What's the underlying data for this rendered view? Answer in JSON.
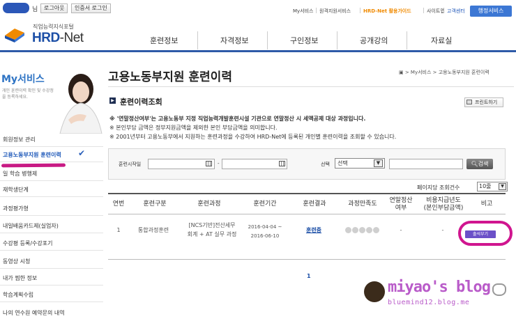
{
  "top": {
    "user_suffix": "님",
    "logout": "로그아웃",
    "cert_login": "인증서 로그인",
    "links": [
      "My서비스",
      "원격지원서비스",
      "HRD-Net 활용가이드",
      "사이트맵",
      "고객센터"
    ],
    "admin": "행정서비스"
  },
  "logo": {
    "sub": "직업능력지식포털",
    "main_a": "HRD",
    "main_b": "-Net"
  },
  "nav": [
    "훈련정보",
    "자격정보",
    "구인정보",
    "공개강의",
    "자료실"
  ],
  "sidebar": {
    "title": "My서비스",
    "desc": "개인 훈련이력 확인 및 수강정을 등록하세요.",
    "items": [
      "회원정보 관리",
      "고용노동부지원 훈련이력",
      "일 학습 병행제",
      "재학생단계",
      "과정평가형",
      "내일배움카드제(실업자)",
      "수강평 등록/수강포기",
      "동영상 시청",
      "내가 찜한 정보",
      "학습계획수립",
      "나의 연수원 예약문의 내역"
    ]
  },
  "page": {
    "title": "고용노동부지원 훈련이력",
    "breadcrumb": "▣ > My서비스 > 고용노동부지원 훈련이력",
    "section": "훈련이력조회",
    "print": "프린트하기"
  },
  "notes": [
    "※ '연말정산여부'는 고용노동부 지정 직업능력개발훈련시설 기관으로 연말정산 시 세액공제 대상 과정입니다.",
    "※ 본인부담 금액은 정부지원금액을 제외한 본인 부담금액을 의미합니다.",
    "※ 2001년부터 고용노동부에서 지원하는 훈련과정을 수강하여 HRD-Net에 등록된 개인별 훈련이력을 조회할 수 있습니다."
  ],
  "search": {
    "start_label": "훈련시작일",
    "dash": "-",
    "select_label": "선택",
    "select_value": "선택",
    "button": "검색"
  },
  "perpage": {
    "label": "페이지당 조회건수",
    "value": "10줄"
  },
  "table": {
    "headers": [
      "연번",
      "훈련구분",
      "훈련과정",
      "훈련기간",
      "훈련결과",
      "과정만족도",
      "연말정산\n여부",
      "비용지급년도\n(본인부담금액)",
      "비고"
    ],
    "row": {
      "no": "1",
      "type": "통합과정훈련",
      "course_1": "[NCS기반]전산세무",
      "course_2": "회계 + AT 실무 과정",
      "period_1": "2016-04-04 ~",
      "period_2": "2016-06-10",
      "result": "훈련중",
      "tax": "-",
      "cost": "-",
      "action": "출석부기"
    }
  },
  "pager": {
    "current": "1"
  },
  "watermark": {
    "title": "miyao's blog",
    "url": "bluemind12.blog.me"
  },
  "colors": {
    "brand": "#1b4ea6",
    "nav_line": "#2e5aa8",
    "highlight": "#c81a84",
    "receipt": "#6b50c8"
  }
}
